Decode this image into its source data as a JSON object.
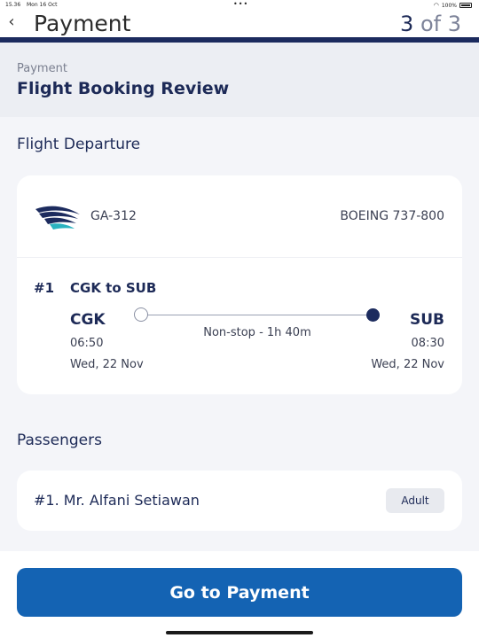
{
  "status_bar": {
    "time": "15.36",
    "date": "Mon 16 Oct",
    "dots": "•••",
    "battery": "100%",
    "wifi_icon": "wifi-icon",
    "battery_icon": "battery-icon"
  },
  "nav": {
    "back_icon": "‹",
    "title": "Payment",
    "step_current": "3",
    "step_separator": " of ",
    "step_total": "3"
  },
  "header": {
    "caption": "Payment",
    "title": "Flight Booking Review"
  },
  "flight_section": {
    "title": "Flight Departure",
    "airline_logo": "airline-bird-logo",
    "flight_number": "GA-312",
    "aircraft": "BOEING 737-800",
    "route_index": "#1",
    "route_name": "CGK to SUB",
    "origin": {
      "code": "CGK",
      "time": "06:50",
      "date": "Wed, 22 Nov"
    },
    "destination": {
      "code": "SUB",
      "time": "08:30",
      "date": "Wed, 22 Nov"
    },
    "duration": "Non-stop - 1h 40m"
  },
  "passengers_section": {
    "title": "Passengers",
    "items": [
      {
        "name": "#1. Mr. Alfani Setiawan",
        "type": "Adult"
      }
    ]
  },
  "footer": {
    "button_label": "Go to Payment"
  },
  "colors": {
    "primary": "#1c2b5e",
    "button": "#1463b3",
    "background": "#f4f5f9"
  }
}
